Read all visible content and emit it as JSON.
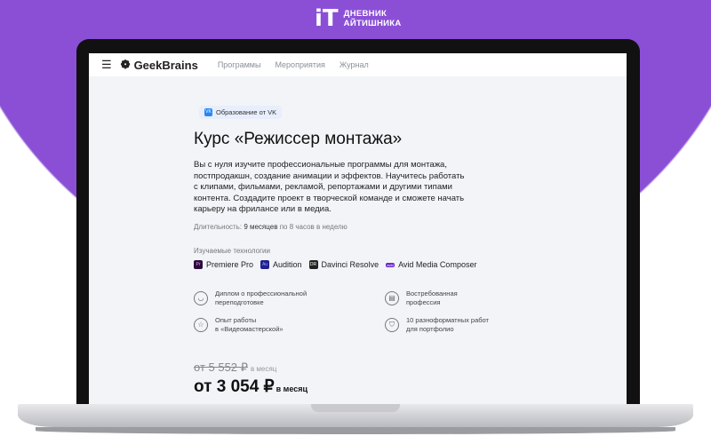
{
  "brand": {
    "logo": "iT",
    "line1": "ДНЕВНИК",
    "line2": "АЙТИШНИКА"
  },
  "nav": {
    "logo": "GeekBrains",
    "links": [
      "Программы",
      "Мероприятия",
      "Журнал"
    ]
  },
  "badge": "Образование от VK",
  "title": "Курс «Режиссер монтажа»",
  "description": "Вы с нуля изучите профессиональные программы для монтажа, постпродакшн, создание анимации и эффектов. Научитесь работать с клипами, фильмами, рекламой, репортажами и другими типами контента. Создадите проект в творческой команде и сможете начать карьеру на фрилансе или в медиа.",
  "duration": {
    "label": "Длительность:",
    "value": "9 месяцев",
    "extra": "по 8 часов в неделю"
  },
  "tech_label": "Изучаемые технологии",
  "techs": [
    {
      "name": "Premiere Pro",
      "icon": "Pr",
      "color": "#2d0a3e"
    },
    {
      "name": "Audition",
      "icon": "Au",
      "color": "#1f1f8f"
    },
    {
      "name": "Davinci Resolve",
      "icon": "DR",
      "color": "#222222"
    },
    {
      "name": "Avid Media Composer",
      "icon": "avid",
      "color": "#6a2bc7"
    }
  ],
  "features": [
    {
      "line1": "Диплом о профессиональной",
      "line2": "переподготовке"
    },
    {
      "line1": "Востребованная",
      "line2": "профессия"
    },
    {
      "line1": "Опыт работы",
      "line2": "в «Видеомастерской»"
    },
    {
      "line1": "10 разноформатных работ",
      "line2": "для портфолио"
    }
  ],
  "price": {
    "old": "от 5 552 ₽",
    "old_unit": "в месяц",
    "new": "от 3 054 ₽",
    "new_unit": "в месяц"
  }
}
